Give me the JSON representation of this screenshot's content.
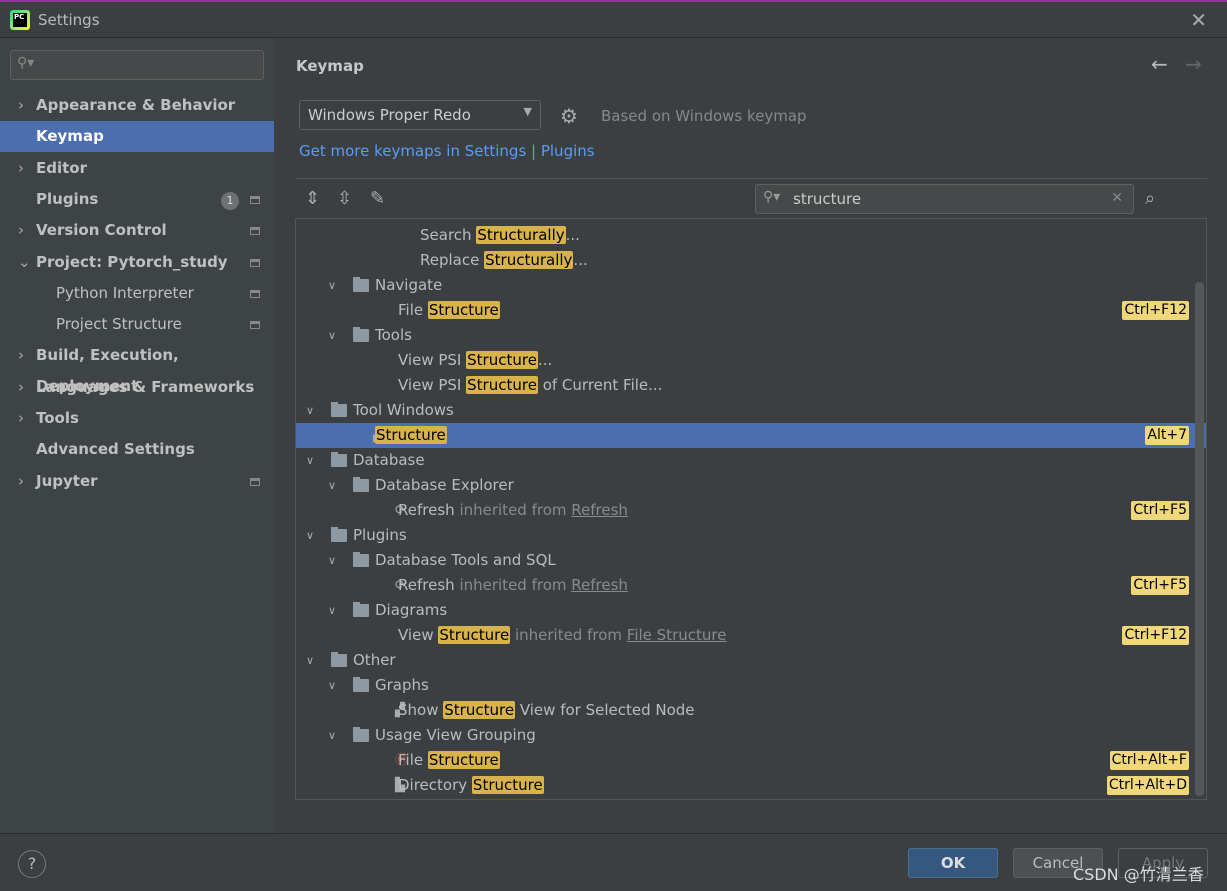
{
  "window": {
    "title": "Settings",
    "close": "✕"
  },
  "sidebar": {
    "search_placeholder": "",
    "items": [
      {
        "label": "Appearance & Behavior",
        "chevron": true,
        "level": 0
      },
      {
        "label": "Keymap",
        "chevron": false,
        "level": 0,
        "selected": true
      },
      {
        "label": "Editor",
        "chevron": true,
        "level": 0
      },
      {
        "label": "Plugins",
        "chevron": false,
        "level": 0,
        "badge": "1",
        "page": true
      },
      {
        "label": "Version Control",
        "chevron": true,
        "level": 0,
        "page": true
      },
      {
        "label": "Project: Pytorch_study",
        "chevron": true,
        "expanded": true,
        "level": 0,
        "page": true
      },
      {
        "label": "Python Interpreter",
        "level": 1,
        "page": true
      },
      {
        "label": "Project Structure",
        "level": 1,
        "page": true
      },
      {
        "label": "Build, Execution, Deployment",
        "chevron": true,
        "level": 0
      },
      {
        "label": "Languages & Frameworks",
        "chevron": true,
        "level": 0
      },
      {
        "label": "Tools",
        "chevron": true,
        "level": 0
      },
      {
        "label": "Advanced Settings",
        "chevron": false,
        "level": 0
      },
      {
        "label": "Jupyter",
        "chevron": true,
        "level": 0,
        "page": true
      }
    ]
  },
  "main": {
    "title": "Keymap",
    "back": "←",
    "forward": "→",
    "keymap_selected": "Windows Proper Redo",
    "based_on": "Based on Windows keymap",
    "get_more_link": "Get more keymaps in Settings | Plugins",
    "search_value": "structure"
  },
  "colors": {
    "accent": "#4b6eaf",
    "highlight": "#d8b24a",
    "shortcut": "#f0d87a",
    "link": "#589df6"
  },
  "tree": [
    {
      "level": 3,
      "parts": [
        [
          "Search",
          ""
        ],
        [
          "Structurally",
          "hl"
        ],
        [
          "...",
          ""
        ]
      ]
    },
    {
      "level": 3,
      "parts": [
        [
          "Replace",
          ""
        ],
        [
          "Structurally",
          "hl"
        ],
        [
          "...",
          ""
        ]
      ]
    },
    {
      "level": 1,
      "folder": true,
      "parts": [
        [
          "Navigate",
          ""
        ]
      ]
    },
    {
      "level": 2,
      "parts": [
        [
          "File",
          ""
        ],
        [
          "Structure",
          "hl"
        ]
      ],
      "shortcut": "Ctrl+F12"
    },
    {
      "level": 1,
      "folder": true,
      "parts": [
        [
          "Tools",
          ""
        ]
      ]
    },
    {
      "level": 2,
      "parts": [
        [
          "View PSI",
          ""
        ],
        [
          "Structure",
          "hl"
        ],
        [
          "...",
          ""
        ]
      ]
    },
    {
      "level": 2,
      "parts": [
        [
          "View PSI",
          ""
        ],
        [
          "Structure",
          "hl"
        ],
        [
          "of Current File...",
          ""
        ]
      ]
    },
    {
      "level": 0,
      "folder": true,
      "parts": [
        [
          "Tool Windows",
          ""
        ]
      ]
    },
    {
      "level": 1,
      "icon": "structure-icon",
      "selected": true,
      "parts": [
        [
          "Structure",
          "hl"
        ]
      ],
      "shortcut": "Alt+7"
    },
    {
      "level": 0,
      "folder": true,
      "parts": [
        [
          "Database",
          ""
        ]
      ]
    },
    {
      "level": 1,
      "folder": true,
      "parts": [
        [
          "Database Explorer",
          ""
        ]
      ]
    },
    {
      "level": 2,
      "icon": "refresh-icon",
      "parts": [
        [
          "Refresh",
          ""
        ],
        [
          "inherited from",
          "dim"
        ],
        [
          "Refresh",
          "lnk"
        ]
      ],
      "shortcut": "Ctrl+F5"
    },
    {
      "level": 0,
      "folder": true,
      "parts": [
        [
          "Plugins",
          ""
        ]
      ]
    },
    {
      "level": 1,
      "folder": true,
      "parts": [
        [
          "Database Tools and SQL",
          ""
        ]
      ]
    },
    {
      "level": 2,
      "icon": "refresh-icon",
      "parts": [
        [
          "Refresh",
          ""
        ],
        [
          "inherited from",
          "dim"
        ],
        [
          "Refresh",
          "lnk"
        ]
      ],
      "shortcut": "Ctrl+F5"
    },
    {
      "level": 1,
      "folder": true,
      "parts": [
        [
          "Diagrams",
          ""
        ]
      ]
    },
    {
      "level": 2,
      "parts": [
        [
          "View",
          ""
        ],
        [
          "Structure",
          "hl"
        ],
        [
          "inherited from",
          "dim"
        ],
        [
          "File Structure",
          "lnk"
        ]
      ],
      "shortcut": "Ctrl+F12"
    },
    {
      "level": 0,
      "folder": true,
      "parts": [
        [
          "Other",
          ""
        ]
      ]
    },
    {
      "level": 1,
      "folder": true,
      "parts": [
        [
          "Graphs",
          ""
        ]
      ]
    },
    {
      "level": 2,
      "icon": "structure-icon",
      "parts": [
        [
          "Show",
          ""
        ],
        [
          "Structure",
          "hl"
        ],
        [
          "View for Selected Node",
          ""
        ]
      ]
    },
    {
      "level": 1,
      "folder": true,
      "parts": [
        [
          "Usage View Grouping",
          ""
        ]
      ]
    },
    {
      "level": 2,
      "icon": "module-icon",
      "parts": [
        [
          "File",
          ""
        ],
        [
          "Structure",
          "hl"
        ]
      ],
      "shortcut": "Ctrl+Alt+F"
    },
    {
      "level": 2,
      "icon": "directory-icon",
      "parts": [
        [
          "Directory",
          ""
        ],
        [
          "Structure",
          "hl"
        ]
      ],
      "shortcut": "Ctrl+Alt+D"
    }
  ],
  "footer": {
    "help": "?",
    "ok": "OK",
    "cancel": "Cancel",
    "apply": "Apply",
    "watermark": "CSDN @竹清兰香"
  }
}
